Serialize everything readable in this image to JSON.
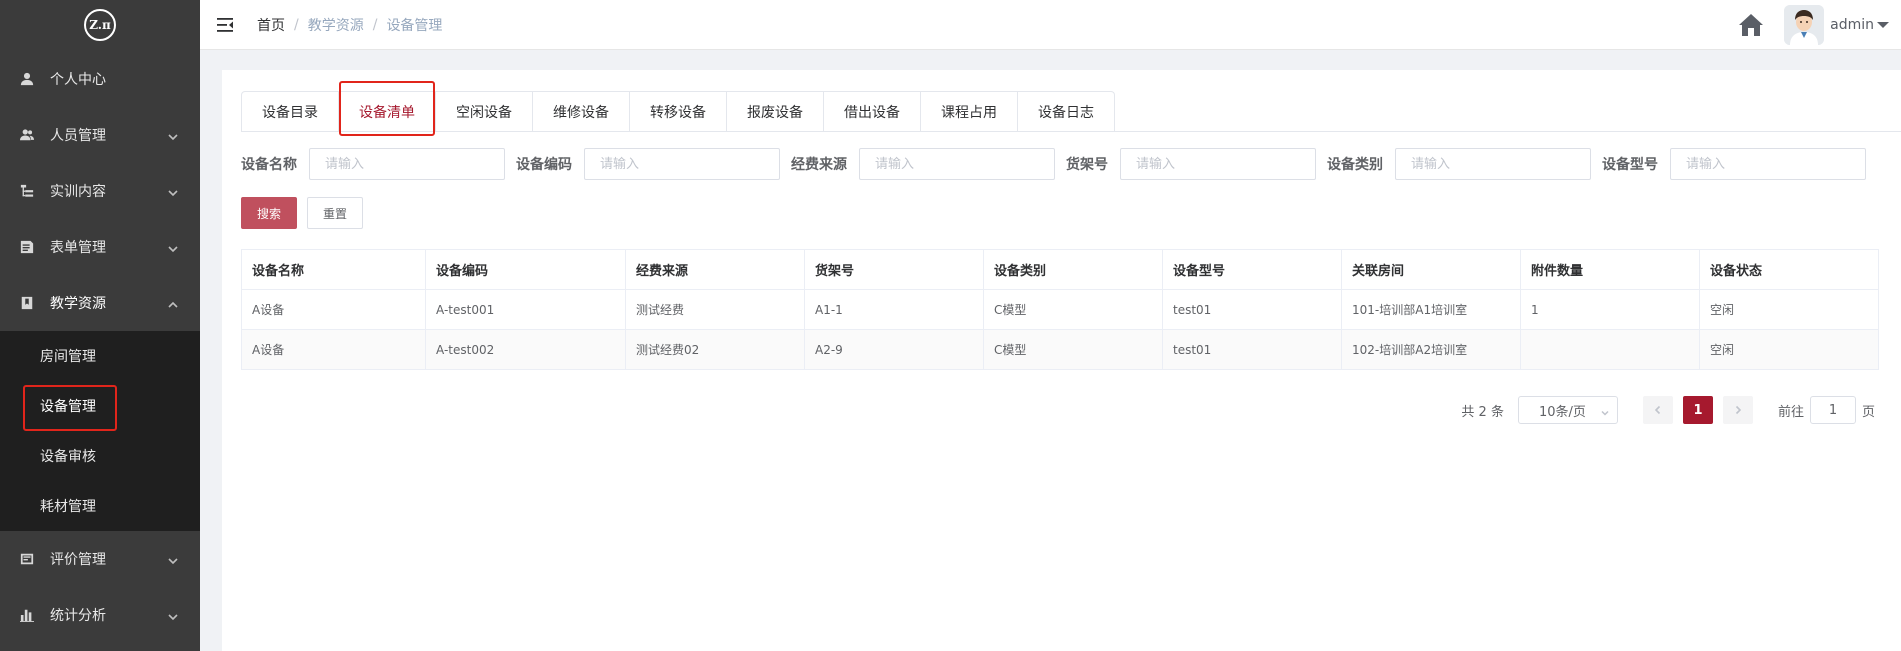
{
  "logo": {
    "text": "Z.π"
  },
  "sidebar": {
    "items": [
      {
        "label": "个人中心",
        "icon": "user-icon",
        "has_children": false
      },
      {
        "label": "人员管理",
        "icon": "users-icon",
        "has_children": true
      },
      {
        "label": "实训内容",
        "icon": "tree-icon",
        "has_children": true
      },
      {
        "label": "表单管理",
        "icon": "form-icon",
        "has_children": true
      },
      {
        "label": "教学资源",
        "icon": "book-icon",
        "has_children": true,
        "open": true
      },
      {
        "label": "评价管理",
        "icon": "evaluation-icon",
        "has_children": true
      },
      {
        "label": "统计分析",
        "icon": "bar-chart-icon",
        "has_children": true
      }
    ],
    "subitems": [
      {
        "label": "房间管理"
      },
      {
        "label": "设备管理",
        "active": true
      },
      {
        "label": "设备审核"
      },
      {
        "label": "耗材管理"
      }
    ]
  },
  "header": {
    "breadcrumb": [
      "首页",
      "教学资源",
      "设备管理"
    ],
    "username": "admin"
  },
  "tabs": [
    {
      "label": "设备目录"
    },
    {
      "label": "设备清单",
      "active": true
    },
    {
      "label": "空闲设备"
    },
    {
      "label": "维修设备"
    },
    {
      "label": "转移设备"
    },
    {
      "label": "报废设备"
    },
    {
      "label": "借出设备"
    },
    {
      "label": "课程占用"
    },
    {
      "label": "设备日志"
    }
  ],
  "filters": {
    "placeholder": "请输入",
    "fields": [
      {
        "label": "设备名称",
        "value": ""
      },
      {
        "label": "设备编码",
        "value": ""
      },
      {
        "label": "经费来源",
        "value": ""
      },
      {
        "label": "货架号",
        "value": ""
      },
      {
        "label": "设备类别",
        "value": ""
      },
      {
        "label": "设备型号",
        "value": ""
      }
    ],
    "search_label": "搜索",
    "reset_label": "重置"
  },
  "table": {
    "columns": [
      "设备名称",
      "设备编码",
      "经费来源",
      "货架号",
      "设备类别",
      "设备型号",
      "关联房间",
      "附件数量",
      "设备状态"
    ],
    "rows": [
      [
        "A设备",
        "A-test001",
        "测试经费",
        "A1-1",
        "C模型",
        "test01",
        "101-培训部A1培训室",
        "1",
        "空闲"
      ],
      [
        "A设备",
        "A-test002",
        "测试经费02",
        "A2-9",
        "C模型",
        "test01",
        "102-培训部A2培训室",
        "",
        "空闲"
      ]
    ]
  },
  "pagination": {
    "total_text": "共 2 条",
    "page_size": "10条/页",
    "current_page": "1",
    "goto_prefix": "前往",
    "goto_value": "1",
    "goto_suffix": "页"
  },
  "colors": {
    "sidebar_bg": "#3b3b3b",
    "submenu_bg": "#1f1f1f",
    "accent": "#a6192e",
    "search_button": "#c0505e",
    "highlight_box": "#e1251b"
  }
}
